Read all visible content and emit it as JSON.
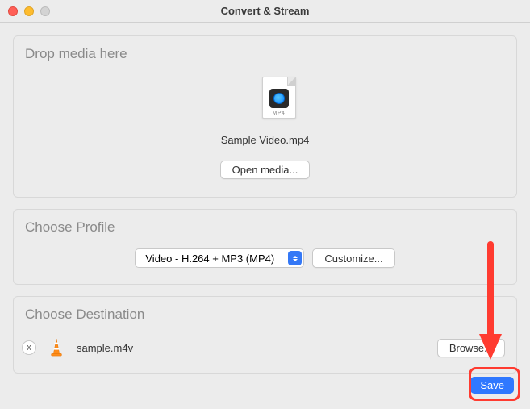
{
  "window": {
    "title": "Convert & Stream"
  },
  "drop": {
    "section_title": "Drop media here",
    "file_type_label": "MP4",
    "file_name": "Sample Video.mp4",
    "open_button": "Open media..."
  },
  "profile": {
    "section_title": "Choose Profile",
    "selected": "Video - H.264 + MP3 (MP4)",
    "customize_button": "Customize..."
  },
  "destination": {
    "section_title": "Choose Destination",
    "file_name": "sample.m4v",
    "browse_button": "Browse...",
    "remove_label": "x"
  },
  "actions": {
    "save": "Save"
  }
}
